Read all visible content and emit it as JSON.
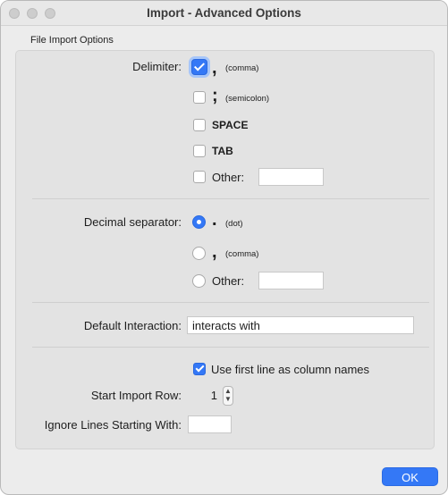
{
  "window": {
    "title": "Import - Advanced Options"
  },
  "group": {
    "label": "File Import Options"
  },
  "delimiter": {
    "label": "Delimiter:",
    "comma_symbol": ",",
    "comma_text": "(comma)",
    "semicolon_symbol": ";",
    "semicolon_text": "(semicolon)",
    "space": "SPACE",
    "tab": "TAB",
    "other": "Other:",
    "other_value": "",
    "checked": [
      "comma"
    ]
  },
  "decimal": {
    "label": "Decimal separator:",
    "dot_symbol": ".",
    "dot_text": "(dot)",
    "comma_symbol": ",",
    "comma_text": "(comma)",
    "other": "Other:",
    "other_value": "",
    "selected": "dot"
  },
  "interaction": {
    "label": "Default Interaction:",
    "value": "interacts with"
  },
  "first_line": {
    "label": "Use first line as column names",
    "checked": true
  },
  "start_row": {
    "label": "Start Import Row:",
    "value": "1"
  },
  "ignore": {
    "label": "Ignore Lines Starting With:",
    "value": ""
  },
  "footer": {
    "ok_label": "OK"
  },
  "colors": {
    "accent": "#3478f6",
    "panel": "#e3e3e3",
    "window": "#ececec"
  }
}
